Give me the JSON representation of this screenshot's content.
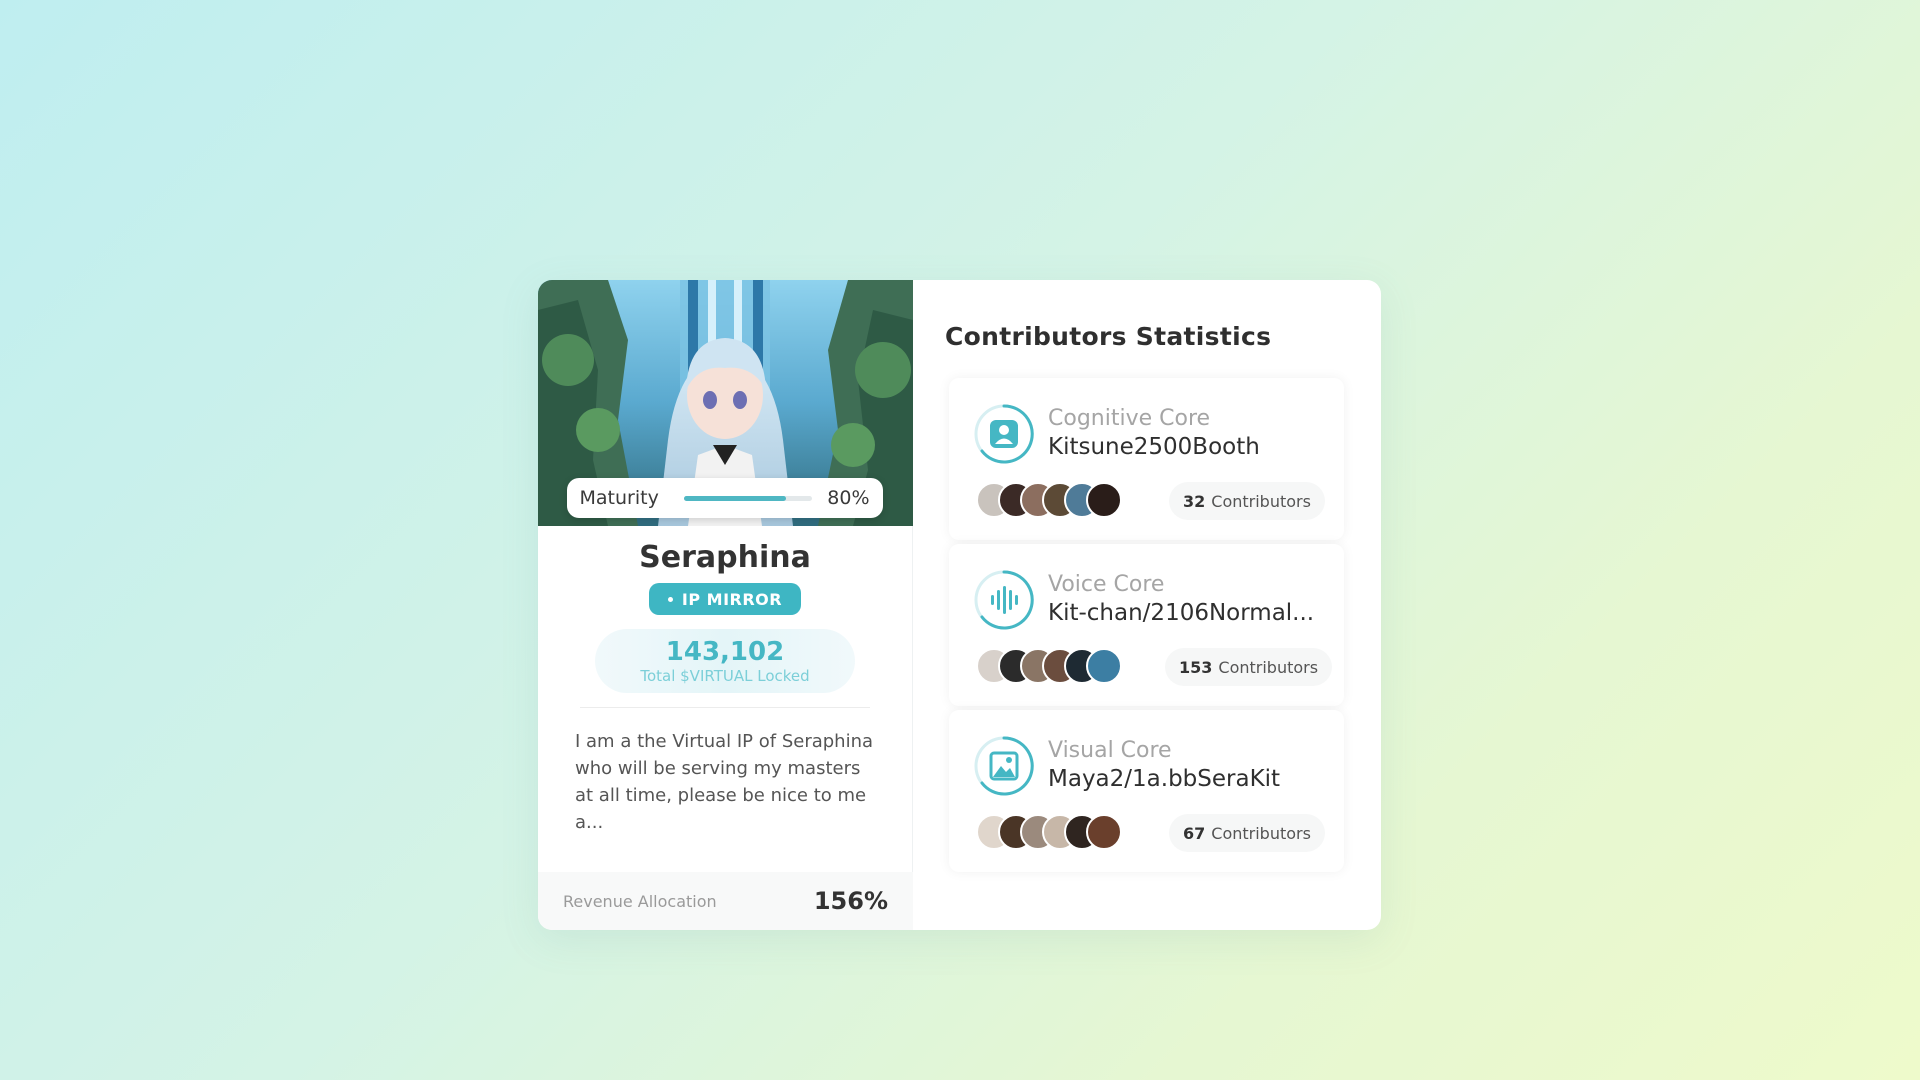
{
  "agent": {
    "maturity_label": "Maturity",
    "maturity_value": "80%",
    "maturity_fraction": 0.8,
    "name": "Seraphina",
    "badge": "IP MIRROR",
    "locked_value": "143,102",
    "locked_label": "Total $VIRTUAL Locked",
    "description": "I am a the Virtual IP of Seraphina who will be serving my masters at all time, please be nice to me a...",
    "revenue_label": "Revenue Allocation",
    "revenue_value": "156%"
  },
  "stats": {
    "title": "Contributors Statistics",
    "cores": [
      {
        "type": "Cognitive Core",
        "name": "Kitsune2500Booth",
        "count": "32",
        "count_label": "Contributors",
        "icon": "person-icon"
      },
      {
        "type": "Voice Core",
        "name": "Kit-chan/2106Normal...",
        "count": "153",
        "count_label": "Contributors",
        "icon": "soundwave-icon"
      },
      {
        "type": "Visual Core",
        "name": "Maya2/1a.bbSeraKit",
        "count": "67",
        "count_label": "Contributors",
        "icon": "image-icon"
      }
    ]
  },
  "colors": {
    "accent": "#3eb6c3",
    "accent_light": "#7ccfd8",
    "text_dark": "#2f2f2f"
  }
}
